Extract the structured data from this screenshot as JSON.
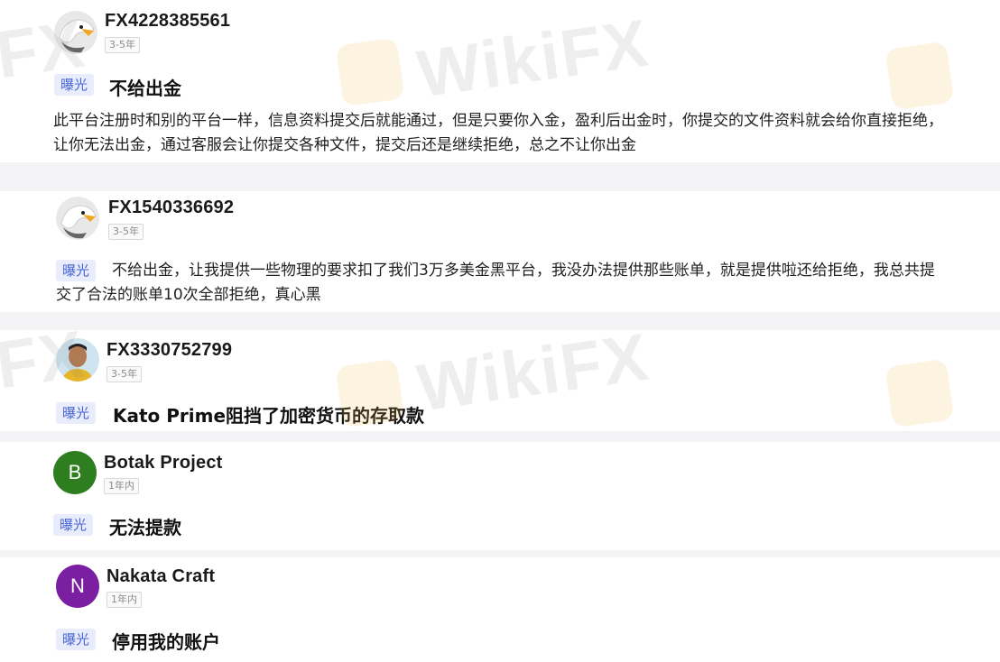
{
  "reviews": [
    {
      "user": "FX4228385561",
      "badge": "3-5年",
      "tag": "曝光",
      "title": "不给出金",
      "body": "此平台注册时和别的平台一样，信息资料提交后就能通过，但是只要你入金，盈利后出金时，你提交的文件资料就会给你直接拒绝，让你无法出金，通过客服会让你提交各种文件，提交后还是继续拒绝，总之不让你出金"
    },
    {
      "user": "FX1540336692",
      "badge": "3-5年",
      "tag": "曝光",
      "title": "",
      "body": "不给出金，让我提供一些物理的要求扣了我们3万多美金黑平台，我没办法提供那些账单，就是提供啦还给拒绝，我总共提交了合法的账单10次全部拒绝，真心黑"
    },
    {
      "user": "FX3330752799",
      "badge": "3-5年",
      "tag": "曝光",
      "title": "Kato Prime阻挡了加密货币的存取款",
      "body": ""
    },
    {
      "user": "Botak Project",
      "avatar_letter": "B",
      "avatar_color": "#2e7d1e",
      "badge": "1年内",
      "tag": "曝光",
      "title": "无法提款",
      "body": ""
    },
    {
      "user": "Nakata Craft",
      "avatar_letter": "N",
      "avatar_color": "#7b1fa2",
      "badge": "1年内",
      "tag": "曝光",
      "title": "停用我的账户",
      "body": ""
    }
  ],
  "watermark": {
    "text": "WikiFX",
    "fragment": "FX"
  }
}
